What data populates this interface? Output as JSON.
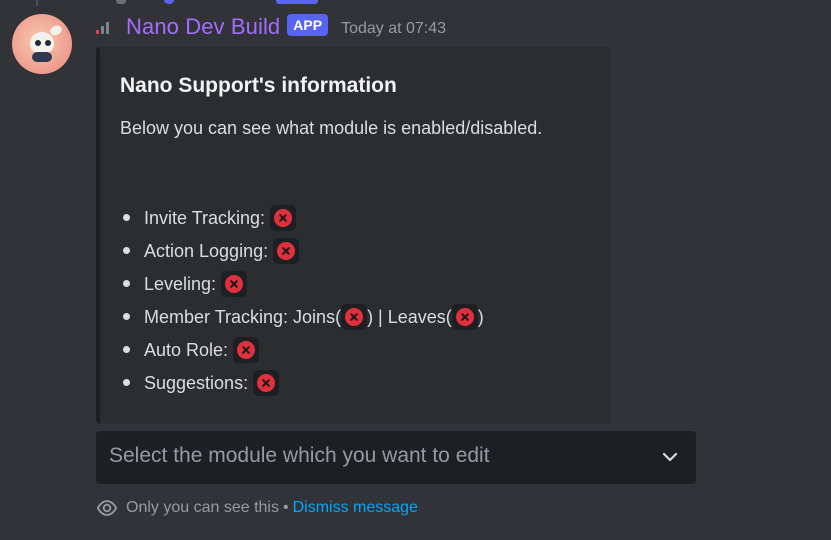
{
  "message": {
    "author": "Nano Dev Build",
    "badge": "APP",
    "timestamp": "Today at 07:43"
  },
  "embed": {
    "title": "Nano Support's information",
    "description": "Below you can see what module is enabled/disabled.",
    "modules": [
      {
        "label": "Invite Tracking:",
        "status": "disabled"
      },
      {
        "label": "Action Logging:",
        "status": "disabled"
      },
      {
        "label": "Leveling:",
        "status": "disabled"
      },
      {
        "label": "Member Tracking: Joins(",
        "mid": ") | Leaves(",
        "end": ")",
        "status": "disabled"
      },
      {
        "label": "Auto Role:",
        "status": "disabled"
      },
      {
        "label": "Suggestions:",
        "status": "disabled"
      }
    ],
    "status_icon": "cross-mark-icon",
    "status_color": "#e0303d",
    "border_color": "#1e1f22"
  },
  "select_menu": {
    "placeholder": "Select the module which you want to edit"
  },
  "ephemeral": {
    "notice": "Only you can see this",
    "separator": "•",
    "dismiss": "Dismiss message"
  },
  "colors": {
    "username": "#a46cff",
    "badge": "#5865f2",
    "link": "#00a8fc",
    "background": "#323339",
    "embed_background": "#2b2d31"
  }
}
